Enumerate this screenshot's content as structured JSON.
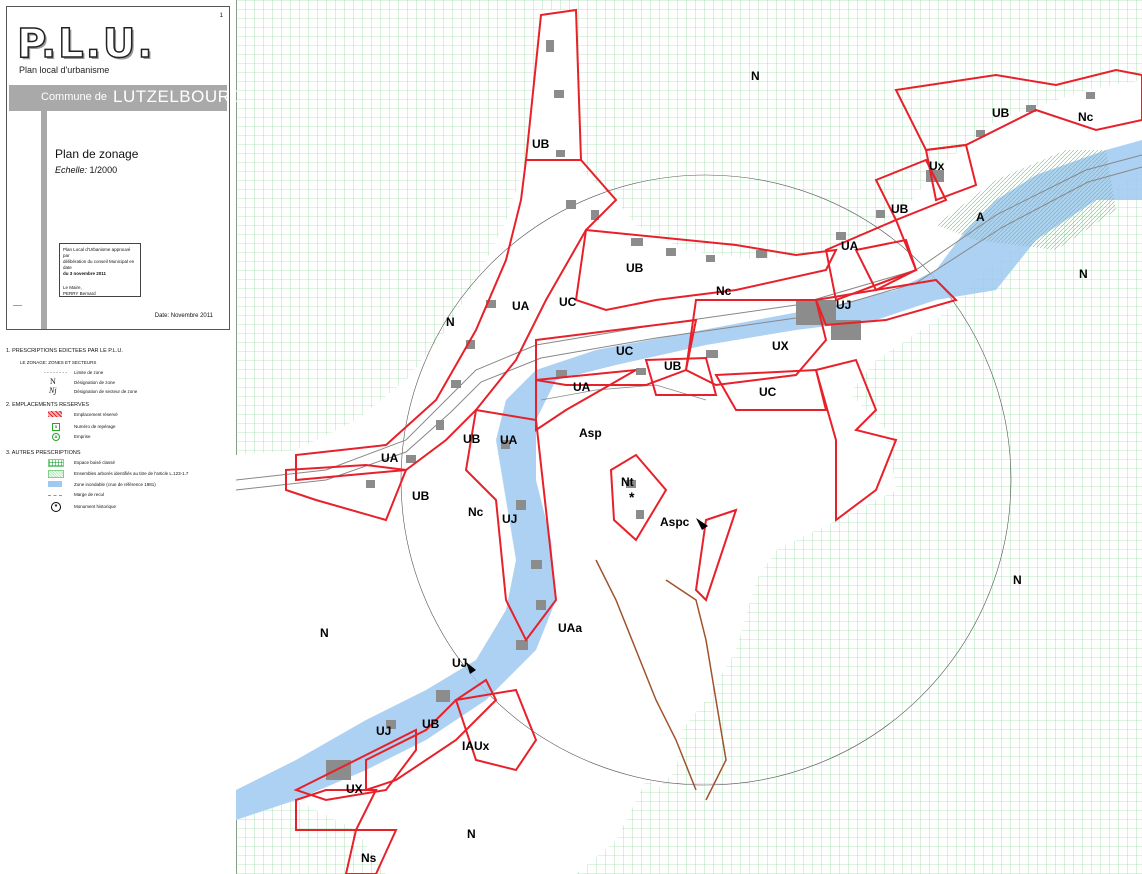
{
  "cartouche": {
    "logo": "P.L.U.",
    "logo_subtitle": "Plan local d'urbanisme",
    "page_number": "1",
    "commune_prefix": "Commune de",
    "commune_name": "LUTZELBOURG",
    "plan_title": "Plan de zonage",
    "scale_label": "Echelle:",
    "scale_value": "1/2000",
    "approval_line1": "Plan Local d'Urbanisme approuvé par",
    "approval_line2": "délibération du conseil Municipal en date",
    "approval_line3": "du 3 novembre 2011",
    "mayor_title": "Le Maire,",
    "mayor_name": "PERRY Bernard",
    "date": "Date: Novembre 2011"
  },
  "legend": {
    "section1": "1. PRESCRIPTIONS EDICTEES PAR LE P.L.U.",
    "subsection1": "LE ZONAGE: ZONES ET SECTEURS",
    "items1": [
      {
        "symbol": "- - - - - - - -",
        "text": "Limite de zone"
      },
      {
        "symbol": "N",
        "text": "Désignation de zone"
      },
      {
        "symbol": "Nj",
        "text": "Désignation de secteur de zone"
      }
    ],
    "section2": "2. EMPLACEMENTS RESERVES",
    "items2": [
      {
        "text": "Emplacement réservé"
      },
      {
        "symbol": "5",
        "text": "Numéro de repérage"
      },
      {
        "symbol": "A",
        "text": "Emprise"
      }
    ],
    "section3": "3. AUTRES PRESCRIPTIONS",
    "items3": [
      {
        "text": "Espace boisé classé"
      },
      {
        "text": "Ensembles arborés identifiés au titre de l'article L.123-1.7"
      },
      {
        "text": "Zone inondable (crue de référence 1981)"
      },
      {
        "text": "Marge de recul"
      },
      {
        "symbol": "*",
        "text": "Monument historique"
      }
    ]
  },
  "map": {
    "colors": {
      "zone_border": "#e8202a",
      "flood": "#9ec9f0",
      "grid": "#7fd08a",
      "cadastre": "#9a9a9a",
      "building": "#8c8c8c",
      "contour": "#a0522d"
    },
    "labels": [
      {
        "text": "N"
      },
      {
        "text": "UB"
      },
      {
        "text": "Nc"
      },
      {
        "text": "Ux"
      },
      {
        "text": "UB"
      },
      {
        "text": "A"
      },
      {
        "text": "UA"
      },
      {
        "text": "N"
      },
      {
        "text": "UB"
      },
      {
        "text": "UB"
      },
      {
        "text": "Nc"
      },
      {
        "text": "UJ"
      },
      {
        "text": "UA"
      },
      {
        "text": "UC"
      },
      {
        "text": "N"
      },
      {
        "text": "UC"
      },
      {
        "text": "UX"
      },
      {
        "text": "UB"
      },
      {
        "text": "UA"
      },
      {
        "text": "UC"
      },
      {
        "text": "Asp"
      },
      {
        "text": "UB"
      },
      {
        "text": "UA"
      },
      {
        "text": "UA"
      },
      {
        "text": "Nt"
      },
      {
        "text": "UB"
      },
      {
        "text": "Nc"
      },
      {
        "text": "UJ"
      },
      {
        "text": "Aspc"
      },
      {
        "text": "N"
      },
      {
        "text": "N"
      },
      {
        "text": "UAa"
      },
      {
        "text": "UJ"
      },
      {
        "text": "UB"
      },
      {
        "text": "UJ"
      },
      {
        "text": "IAUx"
      },
      {
        "text": "UX"
      },
      {
        "text": "N"
      },
      {
        "text": "Ns"
      }
    ]
  }
}
